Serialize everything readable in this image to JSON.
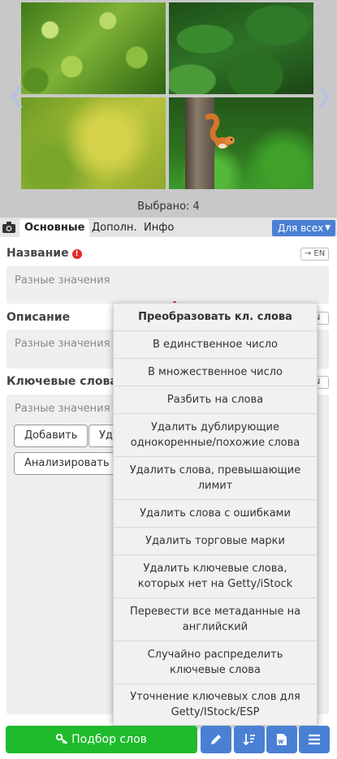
{
  "preview": {
    "selected_text": "Выбрано: 4",
    "nav_left": "❮",
    "nav_right": "❯",
    "images": [
      "lettuce",
      "nettle-leaves",
      "green-yellow-blur",
      "squirrel-on-tree"
    ]
  },
  "tabs": {
    "camera_icon": "camera-icon",
    "items": [
      {
        "label": "Основные",
        "active": true
      },
      {
        "label": "Дополн.",
        "active": false
      },
      {
        "label": "Инфо",
        "active": false
      }
    ],
    "for_all": "Для всех"
  },
  "fields": {
    "title": {
      "label": "Название",
      "warning": "!",
      "en": "→ EN",
      "placeholder": "Разные значения"
    },
    "description": {
      "label": "Описание",
      "en": "EN",
      "placeholder": "Разные значения"
    },
    "keywords": {
      "label": "Ключевые слова",
      "en": "EN",
      "placeholder": "Разные значения"
    }
  },
  "keyword_buttons": {
    "add": "Добавить",
    "second_partial": "Уда",
    "analyze": "Анализировать"
  },
  "menu": {
    "title": "Преобразовать кл. слова",
    "items": [
      "В единственное число",
      "В множественное число",
      "Разбить на слова",
      "Удалить дублирующие однокоренные/похожие слова",
      "Удалить слова, превышающие лимит",
      "Удалить слова с ошибками",
      "Удалить торговые марки",
      "Удалить ключевые слова, которых нет на Getty/iStock",
      "Перевести все метаданные на английский",
      "Случайно распределить ключевые слова",
      "Уточнение ключевых слов для Getty/IStock/ESP"
    ]
  },
  "bottom": {
    "select_words": "Подбор слов",
    "icons": [
      "key-icon",
      "pencil-icon",
      "sort-icon",
      "word-doc-icon",
      "menu-icon"
    ]
  },
  "colors": {
    "accent_blue": "#4a80d4",
    "green": "#1fbb2c",
    "warning_red": "#e02b2b"
  }
}
